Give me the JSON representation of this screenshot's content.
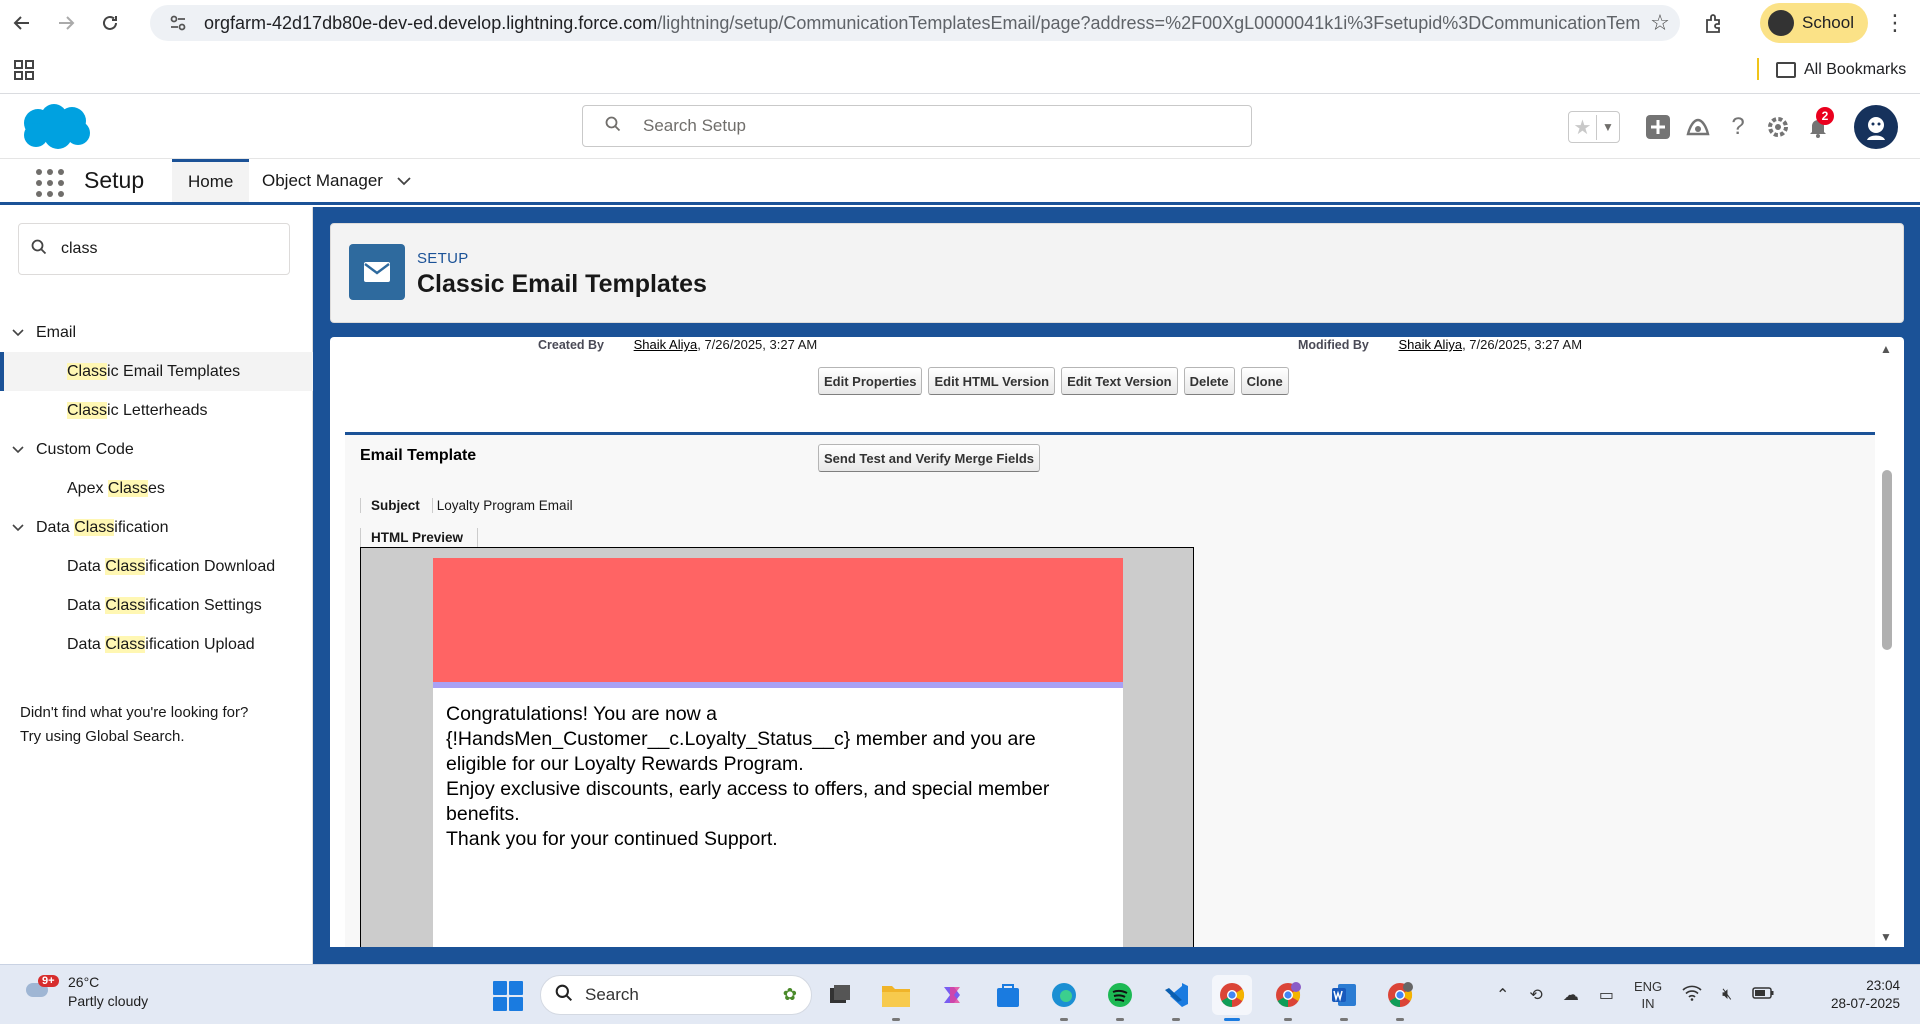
{
  "browser": {
    "url_host": "orgfarm-42d17db80e-dev-ed.develop.lightning.force.com",
    "url_path": "/lightning/setup/CommunicationTemplatesEmail/page?address=%2F00XgL0000041k1i%3Fsetupid%3DCommunicationTempla...",
    "profile_label": "School",
    "all_bookmarks_label": "All Bookmarks"
  },
  "sf_header": {
    "search_placeholder": "Search Setup",
    "notification_count": "2"
  },
  "nav": {
    "app_name": "Setup",
    "tabs": [
      {
        "label": "Home",
        "active": true
      },
      {
        "label": "Object Manager",
        "active": false
      }
    ]
  },
  "sidebar": {
    "quick_find_value": "class",
    "tree": [
      {
        "type": "cat",
        "pre": "Email",
        "hl": "",
        "post": ""
      },
      {
        "type": "leaf",
        "pre": "",
        "hl": "Class",
        "post": "ic Email Templates",
        "selected": true
      },
      {
        "type": "leaf",
        "pre": "",
        "hl": "Class",
        "post": "ic Letterheads"
      },
      {
        "type": "cat",
        "pre": "Custom Code",
        "hl": "",
        "post": ""
      },
      {
        "type": "leaf",
        "pre": "Apex ",
        "hl": "Class",
        "post": "es"
      },
      {
        "type": "cat",
        "pre": "Data ",
        "hl": "Class",
        "post": "ification"
      },
      {
        "type": "leaf",
        "pre": "Data ",
        "hl": "Class",
        "post": "ification Download"
      },
      {
        "type": "leaf",
        "pre": "Data ",
        "hl": "Class",
        "post": "ification Settings"
      },
      {
        "type": "leaf",
        "pre": "Data ",
        "hl": "Class",
        "post": "ification Upload"
      }
    ],
    "not_found_line1": "Didn't find what you're looking for?",
    "not_found_line2": "Try using Global Search."
  },
  "page_header": {
    "eyebrow": "SETUP",
    "title": "Classic Email Templates"
  },
  "record": {
    "created_by_label": "Created By",
    "created_by_name": "Shaik Aliya",
    "created_by_date": ", 7/26/2025, 3:27 AM",
    "modified_by_label": "Modified By",
    "modified_by_name": "Shaik Aliya",
    "modified_by_date": ", 7/26/2025, 3:27 AM",
    "buttons": [
      "Edit Properties",
      "Edit HTML Version",
      "Edit Text Version",
      "Delete",
      "Clone"
    ]
  },
  "template": {
    "section_title": "Email Template",
    "send_test_label": "Send Test and Verify Merge Fields",
    "subject_label": "Subject",
    "subject_value": "Loyalty Program Email",
    "preview_label": "HTML Preview",
    "body_lines": [
      "Congratulations! You are now a",
      "{!HandsMen_Customer__c.Loyalty_Status__c} member and you are",
      "eligible for our Loyalty Rewards Program.",
      "Enjoy exclusive discounts, early access to offers, and special member",
      "benefits.",
      "Thank you for your continued Support."
    ],
    "banner_color": "#ff6464",
    "divider_color": "#a9a1f5"
  },
  "taskbar": {
    "weather_badge": "9+",
    "temperature": "26°C",
    "condition": "Partly cloudy",
    "search_label": "Search",
    "lang_line1": "ENG",
    "lang_line2": "IN",
    "time": "23:04",
    "date": "28-07-2025"
  }
}
